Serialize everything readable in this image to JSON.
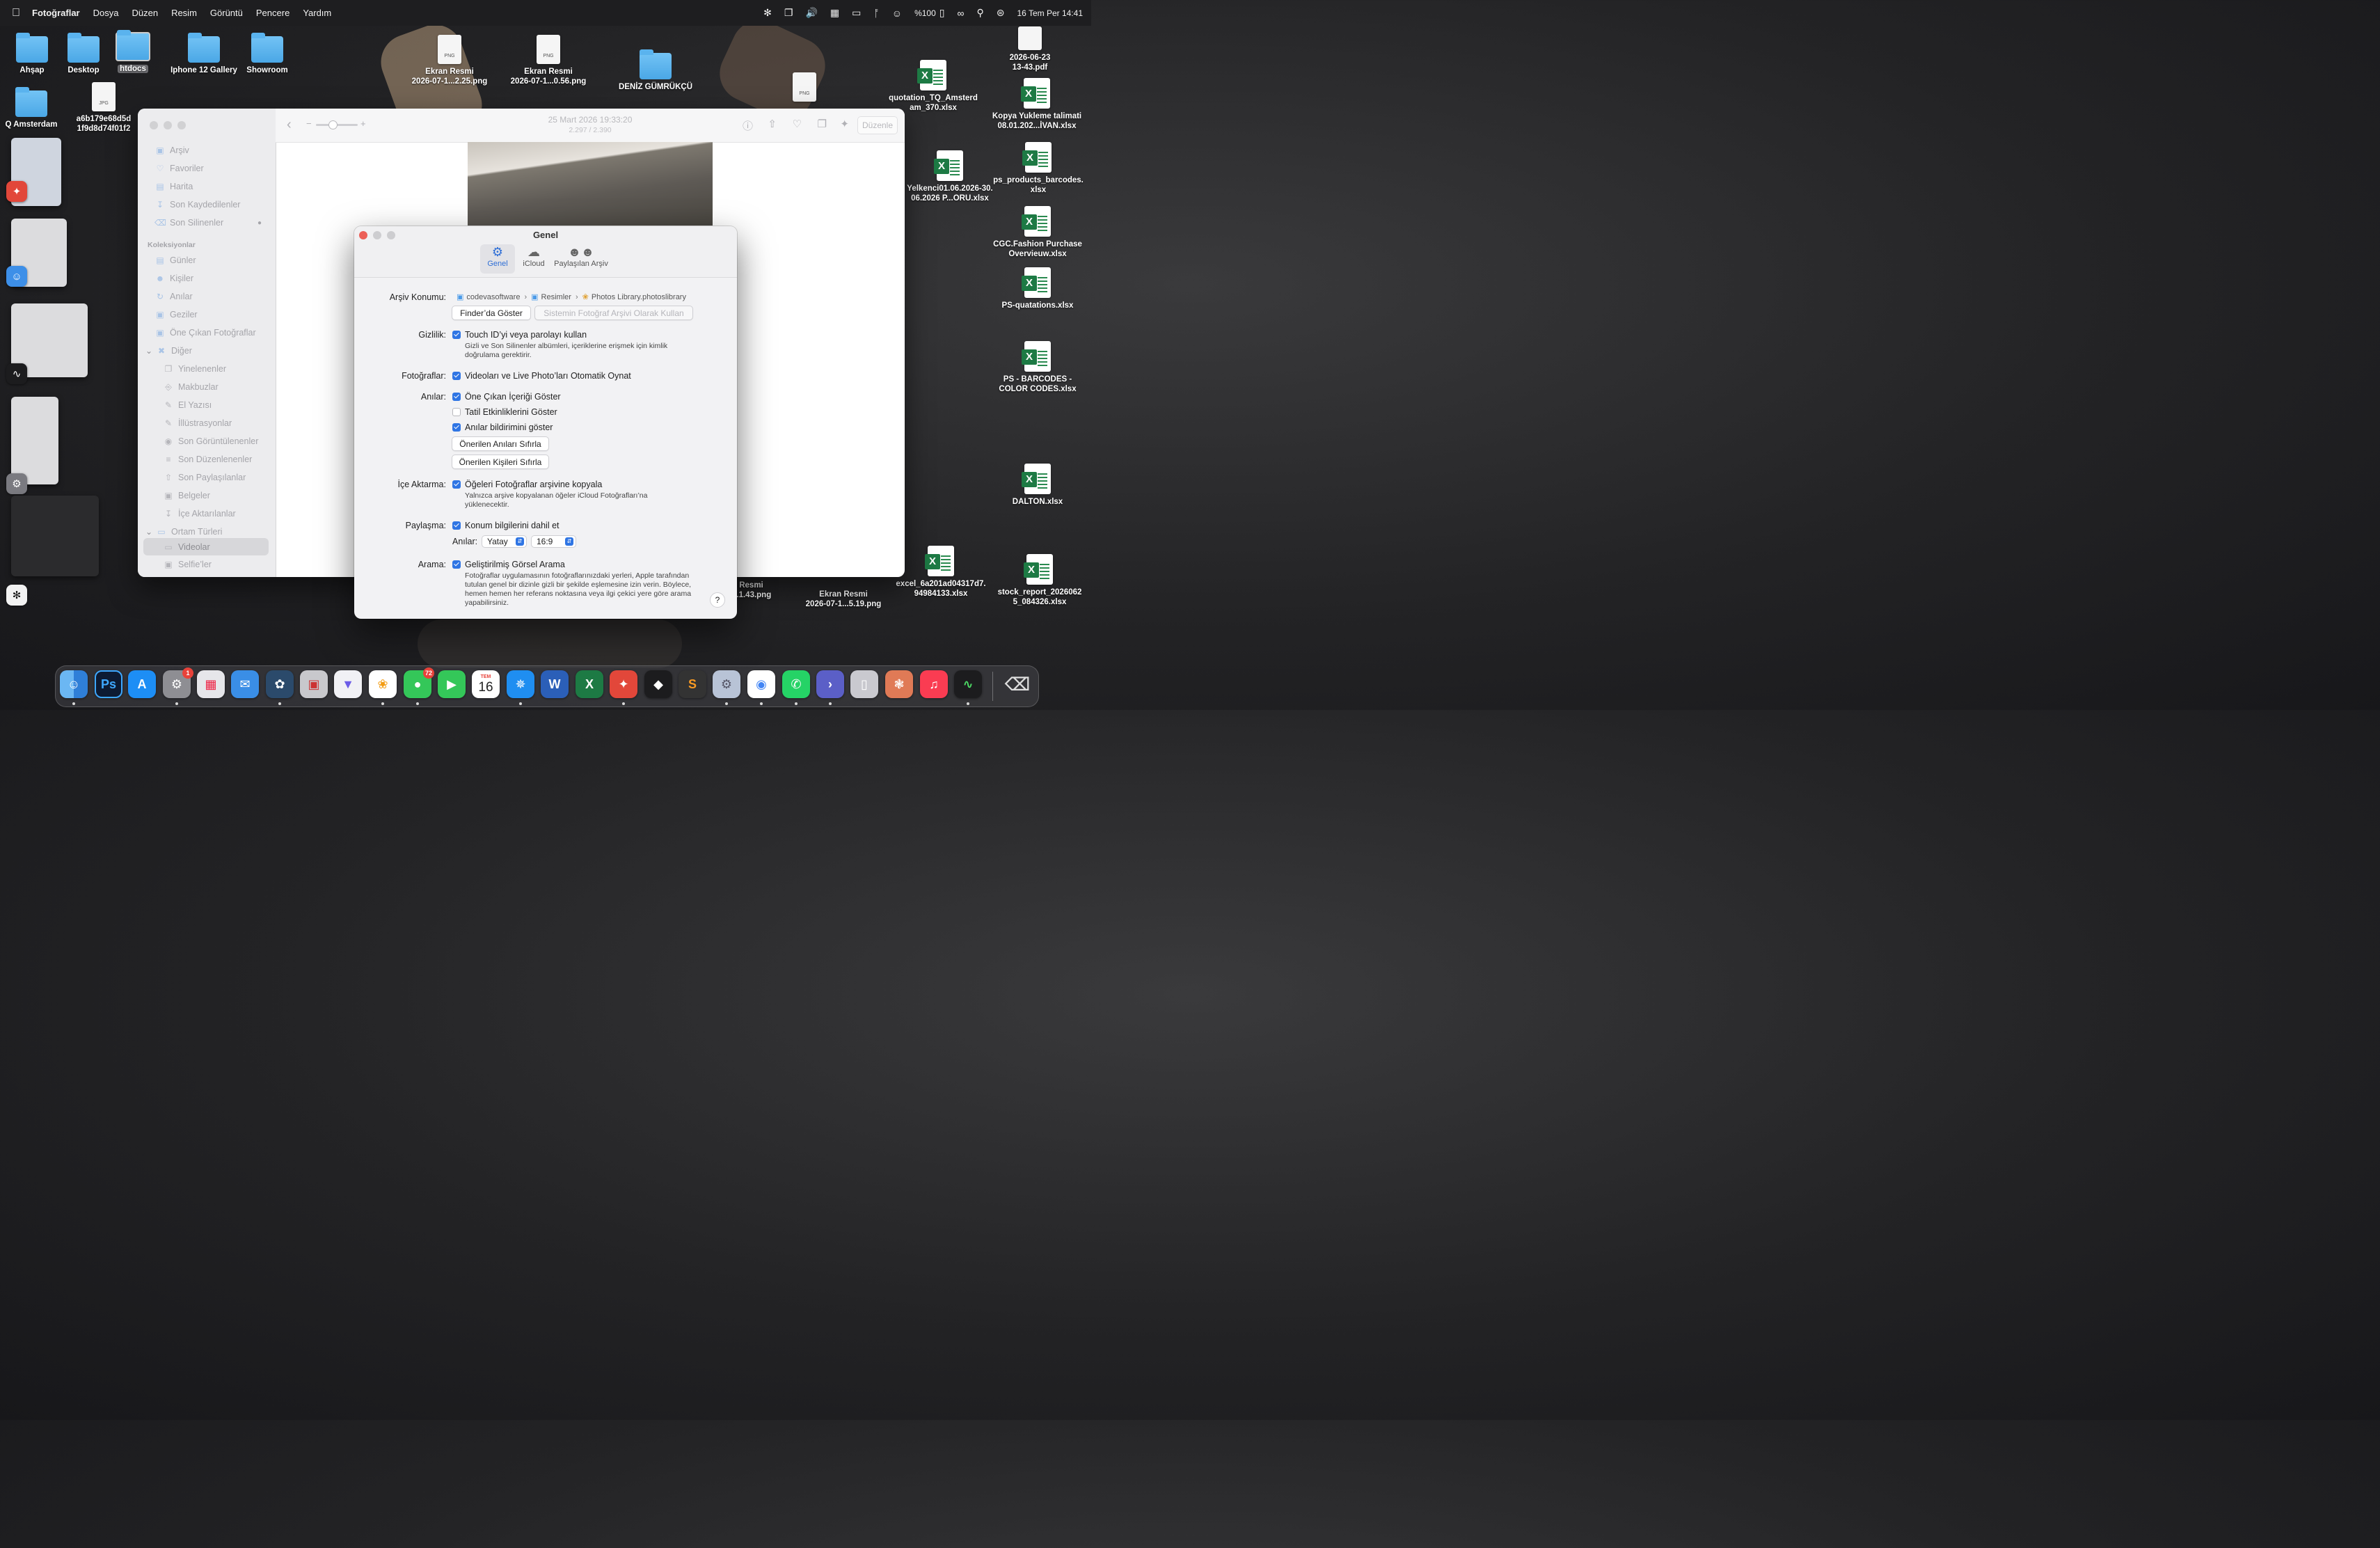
{
  "menubar": {
    "app_name": "Fotoğraflar",
    "menus": [
      "Dosya",
      "Düzen",
      "Resim",
      "Görüntü",
      "Pencere",
      "Yardım"
    ],
    "battery": "%100",
    "datetime": "16 Tem Per  14:41"
  },
  "desktop": {
    "folders": [
      "Ahşap",
      "Desktop",
      "htdocs",
      "Iphone 12 Gallery",
      "Showroom",
      "Q Amsterdam",
      "DENİZ GÜMRÜKÇÜ"
    ],
    "files": {
      "jpg1_line1": "a6b179e68d5d",
      "jpg1_line2": "1f9d8d74f01f2",
      "png1_line1": "Ekran Resmi",
      "png1_line2": "2026-07-1...2.25.png",
      "png2_line1": "Ekran Resmi",
      "png2_line2": "2026-07-1...0.56.png",
      "png3_line1": "n Resmi",
      "png3_line2": "...1.43.png",
      "png4_line1": "Ekran Resmi",
      "png4_line2": "2026-07-1...5.19.png",
      "pdf_line1": "2026-06-23",
      "pdf_line2": "13-43.pdf",
      "png_tag": "PNG",
      "jpg_tag": "JPG"
    },
    "spreadsheets": [
      {
        "line1": "quotation_TQ_Amsterd",
        "line2": "am_370.xlsx"
      },
      {
        "line1": "Kopya Yukleme talimati",
        "line2": "08.01.202...İVAN.xlsx"
      },
      {
        "line1": "Yelkenci01.06.2026-30.",
        "line2": "06.2026 P...ORU.xlsx"
      },
      {
        "line1": "ps_products_barcodes.",
        "line2": "xlsx"
      },
      {
        "line1": "CGC.Fashion Purchase",
        "line2": "Overvieuw.xlsx"
      },
      {
        "line1": "PS-quatations.xlsx",
        "line2": ""
      },
      {
        "line1": "PS - BARCODES -",
        "line2": "COLOR CODES.xlsx"
      },
      {
        "line1": "DALTON.xlsx",
        "line2": ""
      },
      {
        "line1": "excel_6a201ad04317d7.",
        "line2": "94984133.xlsx"
      },
      {
        "line1": "stock_report_2026062",
        "line2": "5_084326.xlsx"
      }
    ]
  },
  "photos": {
    "sidebar": {
      "library": [
        "Arşiv",
        "Favoriler",
        "Harita",
        "Son Kaydedilenler",
        "Son Silinenler"
      ],
      "collections_header": "Koleksiyonlar",
      "collections": [
        "Günler",
        "Kişiler",
        "Anılar",
        "Geziler",
        "Öne Çıkan Fotoğraflar"
      ],
      "other_header": "Diğer",
      "other": [
        "Yinelenenler",
        "Makbuzlar",
        "El Yazısı",
        "İllüstrasyonlar",
        "Son Görüntülenenler",
        "Son Düzenlenenler",
        "Son Paylaşılanlar",
        "Belgeler",
        "İçe Aktarılanlar"
      ],
      "media_header": "Ortam Türleri",
      "media": [
        "Videolar",
        "Selfie’ler"
      ]
    },
    "toolbar": {
      "date": "25 Mart 2026 19:33:20",
      "counter": "2.297 / 2.390",
      "edit_label": "Düzenle"
    }
  },
  "prefs": {
    "title": "Genel",
    "tabs": [
      "Genel",
      "iCloud",
      "Paylaşılan Arşiv"
    ],
    "archive": {
      "label": "Arşiv Konumu:",
      "path": [
        "codevasoftware",
        "Resimler",
        "Photos Library.photoslibrary"
      ],
      "show_in_finder": "Finder’da Göster",
      "use_as_system": "Sistemin Fotoğraf Arşivi Olarak Kullan"
    },
    "privacy": {
      "label": "Gizlilik:",
      "option": "Touch ID’yi veya parolayı kullan",
      "note": "Gizli ve Son Silinenler albümleri, içeriklerine erişmek için kimlik doğrulama gerektirir."
    },
    "photos_section": {
      "label": "Fotoğraflar:",
      "option": "Videoları ve Live Photo’ları Otomatik Oynat"
    },
    "memories": {
      "label": "Anılar:",
      "opt1": "Öne Çıkan İçeriği Göster",
      "opt2": "Tatil Etkinliklerini Göster",
      "opt3": "Anılar bildirimini göster",
      "btn1": "Önerilen Anıları Sıfırla",
      "btn2": "Önerilen Kişileri Sıfırla"
    },
    "import": {
      "label": "İçe Aktarma:",
      "option": "Öğeleri Fotoğraflar arşivine kopyala",
      "note": "Yalnızca arşive kopyalanan öğeler iCloud Fotoğrafları’na yüklenecektir."
    },
    "sharing": {
      "label": "Paylaşma:",
      "option": "Konum bilgilerini dahil et",
      "memories_label": "Anılar:",
      "orientation": "Yatay",
      "ratio": "16:9"
    },
    "search": {
      "label": "Arama:",
      "option": "Geliştirilmiş Görsel Arama",
      "note": "Fotoğraflar uygulamasının fotoğraflarınızdaki yerleri, Apple tarafından tutulan genel bir dizinle gizli bir şekilde eşlemesine izin verin. Böylece, hemen hemen her referans noktasına veya ilgi çekici yere göre arama yapabilirsiniz."
    },
    "help": "?"
  },
  "dock": {
    "calendar_month": "TEM",
    "calendar_day": "16",
    "badge_settings": "1",
    "badge_messages": "72",
    "ps_label": "Ps"
  },
  "colors": {
    "accent": "#2f75e4",
    "close": "#ec5f57",
    "excel": "#1d7a44"
  }
}
